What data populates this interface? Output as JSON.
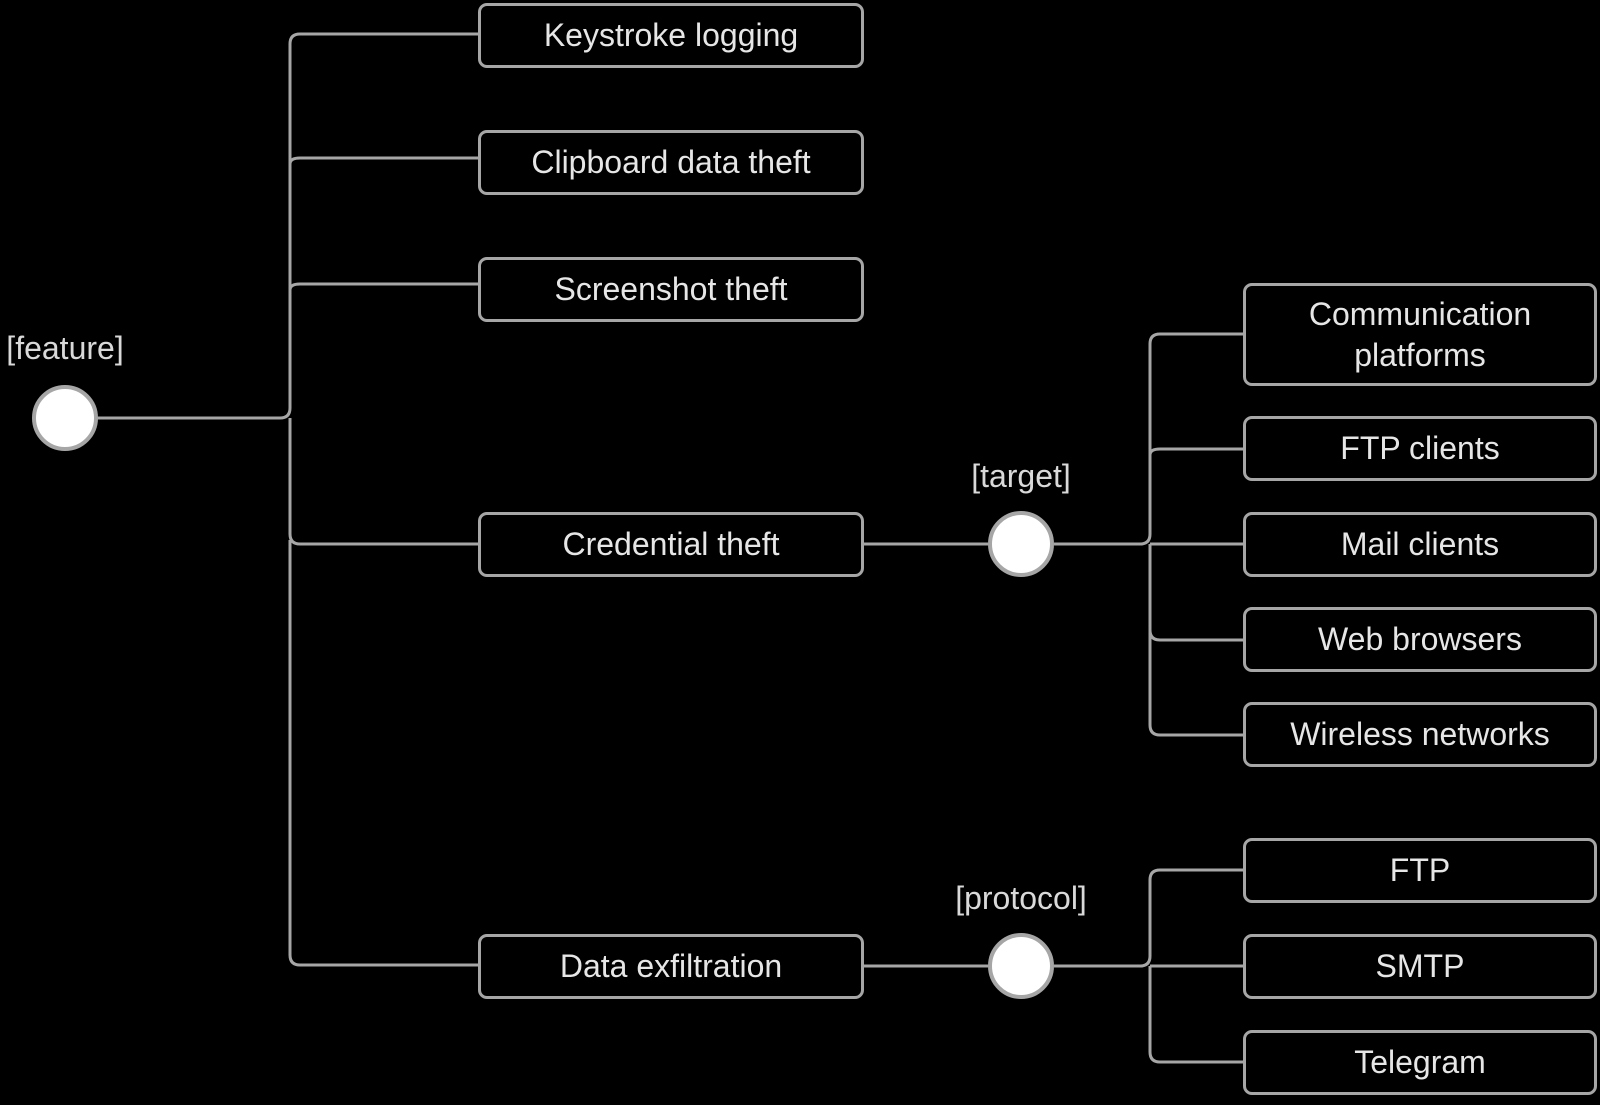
{
  "root": {
    "label": "[feature]",
    "children": [
      {
        "label": "Keystroke logging"
      },
      {
        "label": "Clipboard data theft"
      },
      {
        "label": "Screenshot theft"
      },
      {
        "label": "Credential theft",
        "hub_label": "[target]",
        "children": [
          {
            "label": "Communication platforms"
          },
          {
            "label": "FTP clients"
          },
          {
            "label": "Mail clients"
          },
          {
            "label": "Web browsers"
          },
          {
            "label": "Wireless networks"
          }
        ]
      },
      {
        "label": "Data exfiltration",
        "hub_label": "[protocol]",
        "children": [
          {
            "label": "FTP"
          },
          {
            "label": "SMTP"
          },
          {
            "label": "Telegram"
          }
        ]
      }
    ]
  },
  "colors": {
    "background": "#000000",
    "line": "#a6a6a6",
    "text": "#e6e6e6",
    "hub_fill": "#ffffff"
  }
}
